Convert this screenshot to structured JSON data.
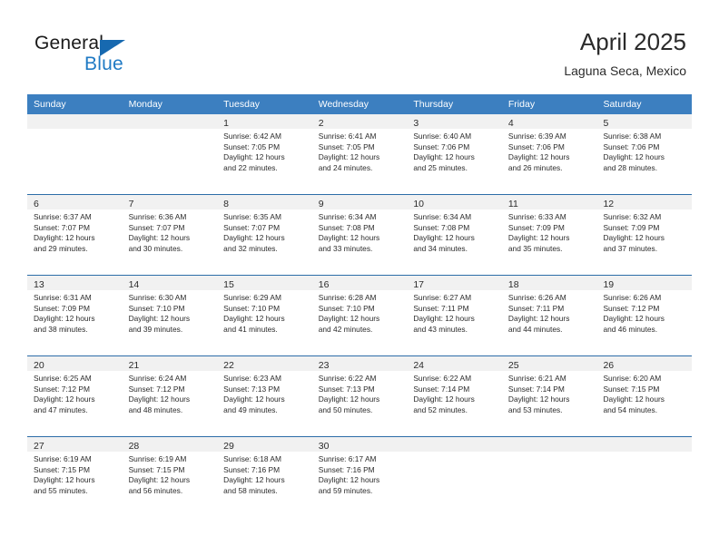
{
  "logo": {
    "line1": "General",
    "line2": "Blue",
    "triangle_icon": "blue-triangle-icon",
    "colors": {
      "general_text": "#1a1a1a",
      "blue_text": "#1f7ac4",
      "triangle": "#1769b0"
    }
  },
  "header": {
    "title": "April 2025",
    "subtitle": "Laguna Seca, Mexico"
  },
  "theme": {
    "header_band": "#3c7fc0",
    "row_divider": "#2d6da8",
    "day_strip": "#f1f1f1",
    "text": "#2b2b2b"
  },
  "weekdays": [
    "Sunday",
    "Monday",
    "Tuesday",
    "Wednesday",
    "Thursday",
    "Friday",
    "Saturday"
  ],
  "weeks": [
    [
      {
        "day": "",
        "sunrise": "",
        "sunset": "",
        "daylight1": "",
        "daylight2": ""
      },
      {
        "day": "",
        "sunrise": "",
        "sunset": "",
        "daylight1": "",
        "daylight2": ""
      },
      {
        "day": "1",
        "sunrise": "Sunrise: 6:42 AM",
        "sunset": "Sunset: 7:05 PM",
        "daylight1": "Daylight: 12 hours",
        "daylight2": "and 22 minutes."
      },
      {
        "day": "2",
        "sunrise": "Sunrise: 6:41 AM",
        "sunset": "Sunset: 7:05 PM",
        "daylight1": "Daylight: 12 hours",
        "daylight2": "and 24 minutes."
      },
      {
        "day": "3",
        "sunrise": "Sunrise: 6:40 AM",
        "sunset": "Sunset: 7:06 PM",
        "daylight1": "Daylight: 12 hours",
        "daylight2": "and 25 minutes."
      },
      {
        "day": "4",
        "sunrise": "Sunrise: 6:39 AM",
        "sunset": "Sunset: 7:06 PM",
        "daylight1": "Daylight: 12 hours",
        "daylight2": "and 26 minutes."
      },
      {
        "day": "5",
        "sunrise": "Sunrise: 6:38 AM",
        "sunset": "Sunset: 7:06 PM",
        "daylight1": "Daylight: 12 hours",
        "daylight2": "and 28 minutes."
      }
    ],
    [
      {
        "day": "6",
        "sunrise": "Sunrise: 6:37 AM",
        "sunset": "Sunset: 7:07 PM",
        "daylight1": "Daylight: 12 hours",
        "daylight2": "and 29 minutes."
      },
      {
        "day": "7",
        "sunrise": "Sunrise: 6:36 AM",
        "sunset": "Sunset: 7:07 PM",
        "daylight1": "Daylight: 12 hours",
        "daylight2": "and 30 minutes."
      },
      {
        "day": "8",
        "sunrise": "Sunrise: 6:35 AM",
        "sunset": "Sunset: 7:07 PM",
        "daylight1": "Daylight: 12 hours",
        "daylight2": "and 32 minutes."
      },
      {
        "day": "9",
        "sunrise": "Sunrise: 6:34 AM",
        "sunset": "Sunset: 7:08 PM",
        "daylight1": "Daylight: 12 hours",
        "daylight2": "and 33 minutes."
      },
      {
        "day": "10",
        "sunrise": "Sunrise: 6:34 AM",
        "sunset": "Sunset: 7:08 PM",
        "daylight1": "Daylight: 12 hours",
        "daylight2": "and 34 minutes."
      },
      {
        "day": "11",
        "sunrise": "Sunrise: 6:33 AM",
        "sunset": "Sunset: 7:09 PM",
        "daylight1": "Daylight: 12 hours",
        "daylight2": "and 35 minutes."
      },
      {
        "day": "12",
        "sunrise": "Sunrise: 6:32 AM",
        "sunset": "Sunset: 7:09 PM",
        "daylight1": "Daylight: 12 hours",
        "daylight2": "and 37 minutes."
      }
    ],
    [
      {
        "day": "13",
        "sunrise": "Sunrise: 6:31 AM",
        "sunset": "Sunset: 7:09 PM",
        "daylight1": "Daylight: 12 hours",
        "daylight2": "and 38 minutes."
      },
      {
        "day": "14",
        "sunrise": "Sunrise: 6:30 AM",
        "sunset": "Sunset: 7:10 PM",
        "daylight1": "Daylight: 12 hours",
        "daylight2": "and 39 minutes."
      },
      {
        "day": "15",
        "sunrise": "Sunrise: 6:29 AM",
        "sunset": "Sunset: 7:10 PM",
        "daylight1": "Daylight: 12 hours",
        "daylight2": "and 41 minutes."
      },
      {
        "day": "16",
        "sunrise": "Sunrise: 6:28 AM",
        "sunset": "Sunset: 7:10 PM",
        "daylight1": "Daylight: 12 hours",
        "daylight2": "and 42 minutes."
      },
      {
        "day": "17",
        "sunrise": "Sunrise: 6:27 AM",
        "sunset": "Sunset: 7:11 PM",
        "daylight1": "Daylight: 12 hours",
        "daylight2": "and 43 minutes."
      },
      {
        "day": "18",
        "sunrise": "Sunrise: 6:26 AM",
        "sunset": "Sunset: 7:11 PM",
        "daylight1": "Daylight: 12 hours",
        "daylight2": "and 44 minutes."
      },
      {
        "day": "19",
        "sunrise": "Sunrise: 6:26 AM",
        "sunset": "Sunset: 7:12 PM",
        "daylight1": "Daylight: 12 hours",
        "daylight2": "and 46 minutes."
      }
    ],
    [
      {
        "day": "20",
        "sunrise": "Sunrise: 6:25 AM",
        "sunset": "Sunset: 7:12 PM",
        "daylight1": "Daylight: 12 hours",
        "daylight2": "and 47 minutes."
      },
      {
        "day": "21",
        "sunrise": "Sunrise: 6:24 AM",
        "sunset": "Sunset: 7:12 PM",
        "daylight1": "Daylight: 12 hours",
        "daylight2": "and 48 minutes."
      },
      {
        "day": "22",
        "sunrise": "Sunrise: 6:23 AM",
        "sunset": "Sunset: 7:13 PM",
        "daylight1": "Daylight: 12 hours",
        "daylight2": "and 49 minutes."
      },
      {
        "day": "23",
        "sunrise": "Sunrise: 6:22 AM",
        "sunset": "Sunset: 7:13 PM",
        "daylight1": "Daylight: 12 hours",
        "daylight2": "and 50 minutes."
      },
      {
        "day": "24",
        "sunrise": "Sunrise: 6:22 AM",
        "sunset": "Sunset: 7:14 PM",
        "daylight1": "Daylight: 12 hours",
        "daylight2": "and 52 minutes."
      },
      {
        "day": "25",
        "sunrise": "Sunrise: 6:21 AM",
        "sunset": "Sunset: 7:14 PM",
        "daylight1": "Daylight: 12 hours",
        "daylight2": "and 53 minutes."
      },
      {
        "day": "26",
        "sunrise": "Sunrise: 6:20 AM",
        "sunset": "Sunset: 7:15 PM",
        "daylight1": "Daylight: 12 hours",
        "daylight2": "and 54 minutes."
      }
    ],
    [
      {
        "day": "27",
        "sunrise": "Sunrise: 6:19 AM",
        "sunset": "Sunset: 7:15 PM",
        "daylight1": "Daylight: 12 hours",
        "daylight2": "and 55 minutes."
      },
      {
        "day": "28",
        "sunrise": "Sunrise: 6:19 AM",
        "sunset": "Sunset: 7:15 PM",
        "daylight1": "Daylight: 12 hours",
        "daylight2": "and 56 minutes."
      },
      {
        "day": "29",
        "sunrise": "Sunrise: 6:18 AM",
        "sunset": "Sunset: 7:16 PM",
        "daylight1": "Daylight: 12 hours",
        "daylight2": "and 58 minutes."
      },
      {
        "day": "30",
        "sunrise": "Sunrise: 6:17 AM",
        "sunset": "Sunset: 7:16 PM",
        "daylight1": "Daylight: 12 hours",
        "daylight2": "and 59 minutes."
      },
      {
        "day": "",
        "sunrise": "",
        "sunset": "",
        "daylight1": "",
        "daylight2": ""
      },
      {
        "day": "",
        "sunrise": "",
        "sunset": "",
        "daylight1": "",
        "daylight2": ""
      },
      {
        "day": "",
        "sunrise": "",
        "sunset": "",
        "daylight1": "",
        "daylight2": ""
      }
    ]
  ]
}
